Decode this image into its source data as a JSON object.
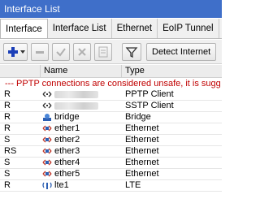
{
  "window": {
    "title": "Interface List"
  },
  "tabs": [
    {
      "label": "Interface",
      "active": true
    },
    {
      "label": "Interface List"
    },
    {
      "label": "Ethernet"
    },
    {
      "label": "EoIP Tunnel"
    },
    {
      "label": "I"
    }
  ],
  "toolbar": {
    "detect_label": "Detect Internet"
  },
  "table": {
    "headers": {
      "name": "Name",
      "type": "Type"
    },
    "warning": "--- PPTP connections are considered unsafe, it is sugg",
    "rows": [
      {
        "flag": "R",
        "icon": "pptp-icon",
        "name": "",
        "type": "PPTP Client",
        "blurred": true
      },
      {
        "flag": "R",
        "icon": "sstp-icon",
        "name": "",
        "type": "SSTP Client",
        "blurred": true
      },
      {
        "flag": "R",
        "icon": "bridge-icon",
        "name": "bridge",
        "type": "Bridge"
      },
      {
        "flag": "R",
        "icon": "ethernet-icon",
        "name": "ether1",
        "type": "Ethernet"
      },
      {
        "flag": "S",
        "icon": "ethernet-icon",
        "name": "ether2",
        "type": "Ethernet"
      },
      {
        "flag": "RS",
        "icon": "ethernet-icon",
        "name": "ether3",
        "type": "Ethernet"
      },
      {
        "flag": "S",
        "icon": "ethernet-icon",
        "name": "ether4",
        "type": "Ethernet"
      },
      {
        "flag": "S",
        "icon": "ethernet-icon",
        "name": "ether5",
        "type": "Ethernet"
      },
      {
        "flag": "R",
        "icon": "lte-icon",
        "name": "lte1",
        "type": "LTE"
      }
    ]
  },
  "colors": {
    "titlebar": "#3f6fc9",
    "warning": "#c00000",
    "add": "#1b3fb8"
  }
}
